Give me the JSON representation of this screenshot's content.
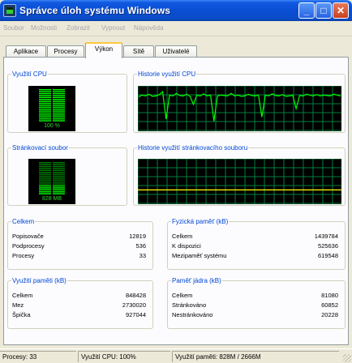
{
  "window": {
    "title": "Správce úloh systému Windows",
    "controls": {
      "minimize": "_",
      "maximize": "□",
      "close": "✕"
    }
  },
  "menu": [
    "Soubor",
    "Možnosti",
    "Zobrazit",
    "Vypnout",
    "Nápověda"
  ],
  "tabs": [
    "Aplikace",
    "Procesy",
    "Výkon",
    "Sítě",
    "Uživatelé"
  ],
  "active_tab": "Výkon",
  "cpu": {
    "usage_label": "Využití CPU",
    "usage_value": "100 %",
    "usage_fraction": 1.0,
    "history_label": "Historie využití CPU",
    "history": [
      0.78,
      0.82,
      0.8,
      0.84,
      0.79,
      0.8,
      0.83,
      0.9,
      0.25,
      0.82,
      0.8,
      0.86,
      0.81,
      0.8,
      0.84,
      0.79,
      0.6,
      0.82,
      0.8,
      0.85,
      0.8,
      0.82,
      0.2,
      0.8,
      0.82,
      0.81,
      0.8,
      0.86,
      0.8,
      0.82,
      0.79,
      0.8,
      0.84,
      0.81,
      0.8,
      0.82,
      0.3,
      0.82,
      0.8,
      0.85,
      0.81,
      0.8,
      0.83,
      0.79,
      0.8,
      0.82,
      0.5,
      0.81,
      0.8,
      0.84,
      0.82,
      0.8,
      0.83,
      0.8,
      0.82,
      0.81,
      0.8,
      0.84,
      0.82,
      0.8
    ]
  },
  "pagefile": {
    "usage_label": "Stránkovací soubor",
    "usage_value": "828 MB",
    "usage_fraction": 0.3,
    "history_label": "Historie využití stránkovacího souboru",
    "history_level": 0.3
  },
  "totals": {
    "label": "Celkem",
    "rows": [
      {
        "label": "Popisovače",
        "value": "12819"
      },
      {
        "label": "Podprocesy",
        "value": "536"
      },
      {
        "label": "Procesy",
        "value": "33"
      }
    ]
  },
  "physical_memory": {
    "label": "Fyzická paměť (kB)",
    "rows": [
      {
        "label": "Celkem",
        "value": "1439784"
      },
      {
        "label": "K dispozici",
        "value": "525636"
      },
      {
        "label": "Mezipaměť systému",
        "value": "619548"
      }
    ]
  },
  "commit_charge": {
    "label": "Využití paměti (kB)",
    "rows": [
      {
        "label": "Celkem",
        "value": "848428"
      },
      {
        "label": "Mez",
        "value": "2730020"
      },
      {
        "label": "Špička",
        "value": "927044"
      }
    ]
  },
  "kernel_memory": {
    "label": "Paměť jádra (kB)",
    "rows": [
      {
        "label": "Celkem",
        "value": "81080"
      },
      {
        "label": "Stránkováno",
        "value": "60852"
      },
      {
        "label": "Nestránkováno",
        "value": "20228"
      }
    ]
  },
  "status": {
    "processes": "Procesy: 33",
    "cpu": "Využití CPU: 100%",
    "memory": "Využití paměti: 828M / 2666M"
  },
  "colors": {
    "graph_line": "#00ff00",
    "graph_grid": "#008040",
    "meter_on": "#00ff00",
    "meter_off": "#007d00",
    "titlebar": "#0a4ed4",
    "group_label": "#0046d5"
  }
}
